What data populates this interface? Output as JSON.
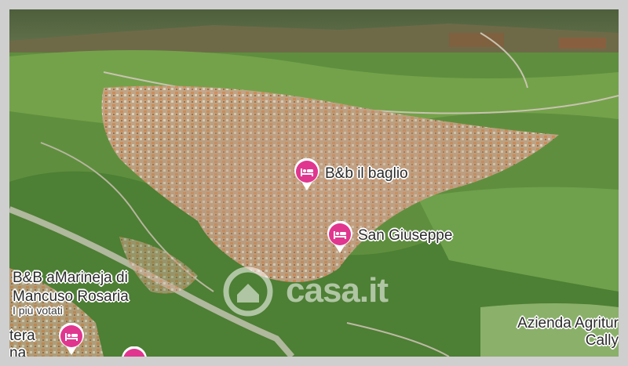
{
  "map": {
    "places": [
      {
        "name": "B&b il baglio",
        "icon": "bed-icon"
      },
      {
        "name": "San Giuseppe",
        "icon": "bed-icon"
      },
      {
        "name_line1": "B&B aMarineja di",
        "name_line2": "Mancuso Rosaria",
        "subtitle": "I più votati"
      },
      {
        "name_line1": "Azienda Agritur",
        "name_line2": "Cally"
      },
      {
        "name_line1": "tera",
        "name_line2": "na"
      }
    ],
    "pin_color": "#e0368f",
    "watermark": "casa.it"
  }
}
